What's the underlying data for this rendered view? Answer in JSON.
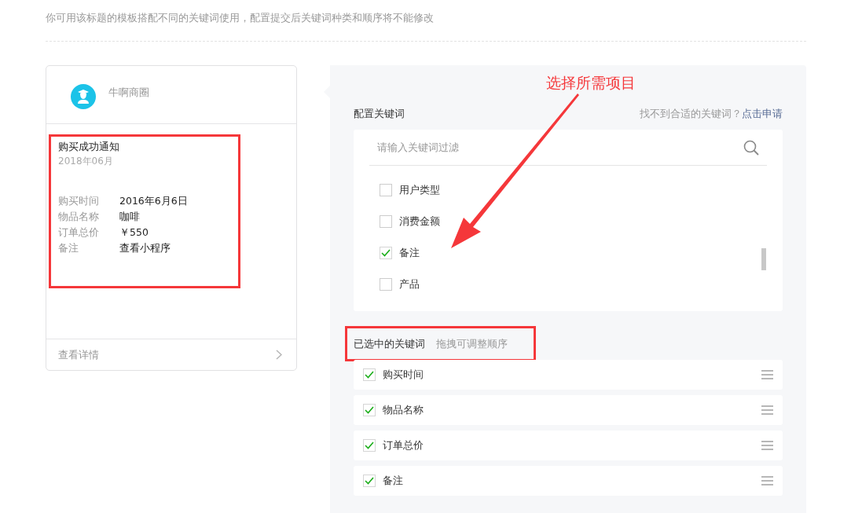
{
  "intro": "你可用该标题的模板搭配不同的关键词使用，配置提交后关键词种类和顺序将不能修改",
  "preview": {
    "account": "牛啊商圈",
    "title": "购买成功通知",
    "date": "2018年06月",
    "fields": [
      {
        "label": "购买时间",
        "value": "2016年6月6日"
      },
      {
        "label": "物品名称",
        "value": "咖啡"
      },
      {
        "label": "订单总价",
        "value": "￥550"
      },
      {
        "label": "备注",
        "value": "查看小程序"
      }
    ],
    "footer_link": "查看详情"
  },
  "config": {
    "heading": "配置关键词",
    "help_text": "找不到合适的关键词？",
    "help_link": "点击申请",
    "search": {
      "placeholder": "请输入关键词过滤"
    },
    "options": [
      {
        "label": "用户类型",
        "checked": false
      },
      {
        "label": "消费金额",
        "checked": false
      },
      {
        "label": "备注",
        "checked": true
      },
      {
        "label": "产品",
        "checked": false
      }
    ]
  },
  "selected": {
    "heading": "已选中的关键词",
    "hint": "拖拽可调整顺序",
    "items": [
      {
        "label": "购买时间",
        "checked": true
      },
      {
        "label": "物品名称",
        "checked": true
      },
      {
        "label": "订单总价",
        "checked": true
      },
      {
        "label": "备注",
        "checked": true
      }
    ]
  },
  "annotation": {
    "text": "选择所需项目"
  }
}
